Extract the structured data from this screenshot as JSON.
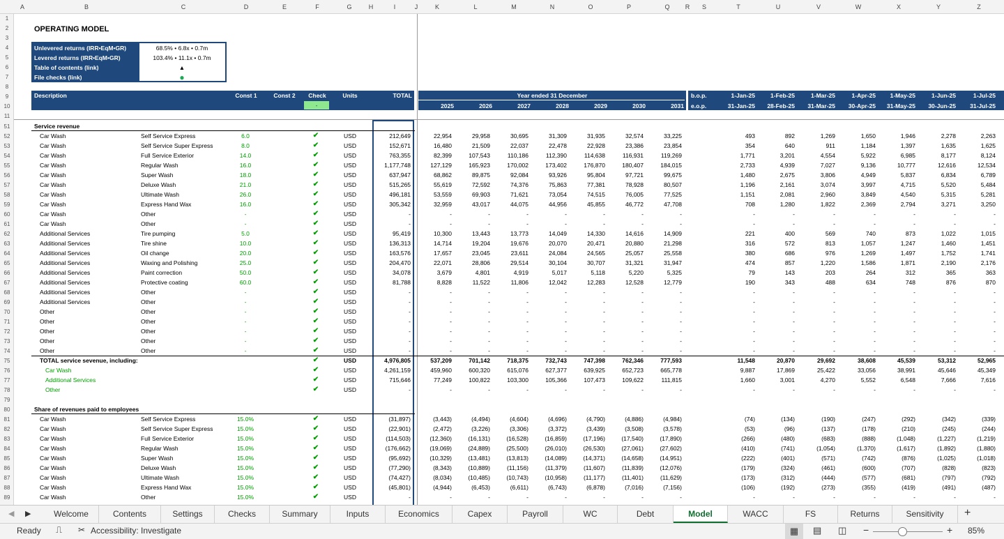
{
  "columns": [
    "A",
    "B",
    "C",
    "D",
    "E",
    "F",
    "G",
    "H",
    "I",
    "J",
    "K",
    "L",
    "M",
    "N",
    "O",
    "P",
    "Q",
    "R",
    "S",
    "T",
    "U",
    "V",
    "W",
    "X",
    "Y",
    "Z"
  ],
  "title": "OPERATING MODEL",
  "summary": [
    {
      "label": "Unlevered returns (IRR•EqM•GR)",
      "value": "68.5% • 6.8x • 0.7m"
    },
    {
      "label": "Levered returns (IRR•EqM•GR)",
      "value": "103.4% • 11.1x • 0.7m"
    },
    {
      "label": "Table of contents (link)",
      "value": "▲"
    },
    {
      "label": "File checks (link)",
      "value": "●"
    }
  ],
  "header": {
    "description": "Description",
    "const1": "Const 1",
    "const2": "Const 2",
    "check": "Check",
    "check_value": "-",
    "units": "Units",
    "total": "TOTAL",
    "year_label": "Year ended 31 December",
    "years": [
      "2025",
      "2026",
      "2027",
      "2028",
      "2029",
      "2030",
      "2031"
    ],
    "bop": "b.o.p.",
    "eop": "e.o.p.",
    "months_start": [
      "1-Jan-25",
      "1-Feb-25",
      "1-Mar-25",
      "1-Apr-25",
      "1-May-25",
      "1-Jun-25",
      "1-Jul-25"
    ],
    "months_end": [
      "31-Jan-25",
      "28-Feb-25",
      "31-Mar-25",
      "30-Apr-25",
      "31-May-25",
      "30-Jun-25",
      "31-Jul-25"
    ]
  },
  "sections": {
    "service_revenue": "Service revenue",
    "share": "Share of revenues paid to employees",
    "total_label": "TOTAL service sevenue, including:"
  },
  "rows": [
    {
      "n": "51",
      "kind": "section",
      "key": "service_revenue"
    },
    {
      "n": "52",
      "a": "Car Wash",
      "b": "Self Service Express",
      "c": "6.0",
      "u": "USD",
      "t": "212,649",
      "y": [
        "22,954",
        "29,958",
        "30,695",
        "31,309",
        "31,935",
        "32,574",
        "33,225"
      ],
      "m": [
        "493",
        "892",
        "1,269",
        "1,650",
        "1,946",
        "2,278",
        "2,263"
      ]
    },
    {
      "n": "53",
      "a": "Car Wash",
      "b": "Self Service Super Express",
      "c": "8.0",
      "u": "USD",
      "t": "152,671",
      "y": [
        "16,480",
        "21,509",
        "22,037",
        "22,478",
        "22,928",
        "23,386",
        "23,854"
      ],
      "m": [
        "354",
        "640",
        "911",
        "1,184",
        "1,397",
        "1,635",
        "1,625"
      ]
    },
    {
      "n": "54",
      "a": "Car Wash",
      "b": "Full Service Exterior",
      "c": "14.0",
      "u": "USD",
      "t": "763,355",
      "y": [
        "82,399",
        "107,543",
        "110,186",
        "112,390",
        "114,638",
        "116,931",
        "119,269"
      ],
      "m": [
        "1,771",
        "3,201",
        "4,554",
        "5,922",
        "6,985",
        "8,177",
        "8,124"
      ]
    },
    {
      "n": "55",
      "a": "Car Wash",
      "b": "Regular Wash",
      "c": "16.0",
      "u": "USD",
      "t": "1,177,748",
      "y": [
        "127,129",
        "165,923",
        "170,002",
        "173,402",
        "176,870",
        "180,407",
        "184,015"
      ],
      "m": [
        "2,733",
        "4,939",
        "7,027",
        "9,136",
        "10,777",
        "12,616",
        "12,534"
      ]
    },
    {
      "n": "56",
      "a": "Car Wash",
      "b": "Super Wash",
      "c": "18.0",
      "u": "USD",
      "t": "637,947",
      "y": [
        "68,862",
        "89,875",
        "92,084",
        "93,926",
        "95,804",
        "97,721",
        "99,675"
      ],
      "m": [
        "1,480",
        "2,675",
        "3,806",
        "4,949",
        "5,837",
        "6,834",
        "6,789"
      ]
    },
    {
      "n": "57",
      "a": "Car Wash",
      "b": "Deluxe Wash",
      "c": "21.0",
      "u": "USD",
      "t": "515,265",
      "y": [
        "55,619",
        "72,592",
        "74,376",
        "75,863",
        "77,381",
        "78,928",
        "80,507"
      ],
      "m": [
        "1,196",
        "2,161",
        "3,074",
        "3,997",
        "4,715",
        "5,520",
        "5,484"
      ]
    },
    {
      "n": "58",
      "a": "Car Wash",
      "b": "Ultimate Wash",
      "c": "26.0",
      "u": "USD",
      "t": "496,181",
      "y": [
        "53,559",
        "69,903",
        "71,621",
        "73,054",
        "74,515",
        "76,005",
        "77,525"
      ],
      "m": [
        "1,151",
        "2,081",
        "2,960",
        "3,849",
        "4,540",
        "5,315",
        "5,281"
      ]
    },
    {
      "n": "59",
      "a": "Car Wash",
      "b": "Express Hand Wax",
      "c": "16.0",
      "u": "USD",
      "t": "305,342",
      "y": [
        "32,959",
        "43,017",
        "44,075",
        "44,956",
        "45,855",
        "46,772",
        "47,708"
      ],
      "m": [
        "708",
        "1,280",
        "1,822",
        "2,369",
        "2,794",
        "3,271",
        "3,250"
      ]
    },
    {
      "n": "60",
      "a": "Car Wash",
      "b": "Other",
      "c": "-",
      "u": "USD",
      "t": "-",
      "y": [
        "-",
        "-",
        "-",
        "-",
        "-",
        "-",
        "-"
      ],
      "m": [
        "-",
        "-",
        "-",
        "-",
        "-",
        "-",
        "-"
      ]
    },
    {
      "n": "61",
      "a": "Car Wash",
      "b": "Other",
      "c": "-",
      "u": "USD",
      "t": "-",
      "y": [
        "-",
        "-",
        "-",
        "-",
        "-",
        "-",
        "-"
      ],
      "m": [
        "-",
        "-",
        "-",
        "-",
        "-",
        "-",
        "-"
      ]
    },
    {
      "n": "62",
      "a": "Additional Services",
      "b": "Tire pumping",
      "c": "5.0",
      "u": "USD",
      "t": "95,419",
      "y": [
        "10,300",
        "13,443",
        "13,773",
        "14,049",
        "14,330",
        "14,616",
        "14,909"
      ],
      "m": [
        "221",
        "400",
        "569",
        "740",
        "873",
        "1,022",
        "1,015"
      ]
    },
    {
      "n": "63",
      "a": "Additional Services",
      "b": "Tire shine",
      "c": "10.0",
      "u": "USD",
      "t": "136,313",
      "y": [
        "14,714",
        "19,204",
        "19,676",
        "20,070",
        "20,471",
        "20,880",
        "21,298"
      ],
      "m": [
        "316",
        "572",
        "813",
        "1,057",
        "1,247",
        "1,460",
        "1,451"
      ]
    },
    {
      "n": "64",
      "a": "Additional Services",
      "b": "Oil change",
      "c": "20.0",
      "u": "USD",
      "t": "163,576",
      "y": [
        "17,657",
        "23,045",
        "23,611",
        "24,084",
        "24,565",
        "25,057",
        "25,558"
      ],
      "m": [
        "380",
        "686",
        "976",
        "1,269",
        "1,497",
        "1,752",
        "1,741"
      ]
    },
    {
      "n": "65",
      "a": "Additional Services",
      "b": "Waxing and Polishing",
      "c": "25.0",
      "u": "USD",
      "t": "204,470",
      "y": [
        "22,071",
        "28,806",
        "29,514",
        "30,104",
        "30,707",
        "31,321",
        "31,947"
      ],
      "m": [
        "474",
        "857",
        "1,220",
        "1,586",
        "1,871",
        "2,190",
        "2,176"
      ]
    },
    {
      "n": "66",
      "a": "Additional Services",
      "b": "Paint correction",
      "c": "50.0",
      "u": "USD",
      "t": "34,078",
      "y": [
        "3,679",
        "4,801",
        "4,919",
        "5,017",
        "5,118",
        "5,220",
        "5,325"
      ],
      "m": [
        "79",
        "143",
        "203",
        "264",
        "312",
        "365",
        "363"
      ]
    },
    {
      "n": "67",
      "a": "Additional Services",
      "b": "Protective coating",
      "c": "60.0",
      "u": "USD",
      "t": "81,788",
      "y": [
        "8,828",
        "11,522",
        "11,806",
        "12,042",
        "12,283",
        "12,528",
        "12,779"
      ],
      "m": [
        "190",
        "343",
        "488",
        "634",
        "748",
        "876",
        "870"
      ]
    },
    {
      "n": "68",
      "a": "Additional Services",
      "b": "Other",
      "c": "-",
      "u": "USD",
      "t": "-",
      "y": [
        "-",
        "-",
        "-",
        "-",
        "-",
        "-",
        "-"
      ],
      "m": [
        "-",
        "-",
        "-",
        "-",
        "-",
        "-",
        "-"
      ]
    },
    {
      "n": "69",
      "a": "Additional Services",
      "b": "Other",
      "c": "-",
      "u": "USD",
      "t": "-",
      "y": [
        "-",
        "-",
        "-",
        "-",
        "-",
        "-",
        "-"
      ],
      "m": [
        "-",
        "-",
        "-",
        "-",
        "-",
        "-",
        "-"
      ]
    },
    {
      "n": "70",
      "a": "Other",
      "b": "Other",
      "c": "-",
      "u": "USD",
      "t": "-",
      "y": [
        "-",
        "-",
        "-",
        "-",
        "-",
        "-",
        "-"
      ],
      "m": [
        "-",
        "-",
        "-",
        "-",
        "-",
        "-",
        "-"
      ]
    },
    {
      "n": "71",
      "a": "Other",
      "b": "Other",
      "c": "-",
      "u": "USD",
      "t": "-",
      "y": [
        "-",
        "-",
        "-",
        "-",
        "-",
        "-",
        "-"
      ],
      "m": [
        "-",
        "-",
        "-",
        "-",
        "-",
        "-",
        "-"
      ]
    },
    {
      "n": "72",
      "a": "Other",
      "b": "Other",
      "c": "-",
      "u": "USD",
      "t": "-",
      "y": [
        "-",
        "-",
        "-",
        "-",
        "-",
        "-",
        "-"
      ],
      "m": [
        "-",
        "-",
        "-",
        "-",
        "-",
        "-",
        "-"
      ]
    },
    {
      "n": "73",
      "a": "Other",
      "b": "Other",
      "c": "-",
      "u": "USD",
      "t": "-",
      "y": [
        "-",
        "-",
        "-",
        "-",
        "-",
        "-",
        "-"
      ],
      "m": [
        "-",
        "-",
        "-",
        "-",
        "-",
        "-",
        "-"
      ]
    },
    {
      "n": "74",
      "a": "Other",
      "b": "Other",
      "c": "-",
      "u": "USD",
      "t": "-",
      "y": [
        "-",
        "-",
        "-",
        "-",
        "-",
        "-",
        "-"
      ],
      "m": [
        "-",
        "-",
        "-",
        "-",
        "-",
        "-",
        "-"
      ]
    },
    {
      "n": "75",
      "kind": "total",
      "u": "USD",
      "t": "4,976,805",
      "y": [
        "537,209",
        "701,142",
        "718,375",
        "732,743",
        "747,398",
        "762,346",
        "777,593"
      ],
      "m": [
        "11,548",
        "20,870",
        "29,692",
        "38,608",
        "45,539",
        "53,312",
        "52,965"
      ]
    },
    {
      "n": "76",
      "kind": "sub",
      "a": "Car Wash",
      "u": "USD",
      "t": "4,261,159",
      "y": [
        "459,960",
        "600,320",
        "615,076",
        "627,377",
        "639,925",
        "652,723",
        "665,778"
      ],
      "m": [
        "9,887",
        "17,869",
        "25,422",
        "33,056",
        "38,991",
        "45,646",
        "45,349"
      ]
    },
    {
      "n": "77",
      "kind": "sub",
      "a": "Additional Services",
      "u": "USD",
      "t": "715,646",
      "y": [
        "77,249",
        "100,822",
        "103,300",
        "105,366",
        "107,473",
        "109,622",
        "111,815"
      ],
      "m": [
        "1,660",
        "3,001",
        "4,270",
        "5,552",
        "6,548",
        "7,666",
        "7,616"
      ]
    },
    {
      "n": "78",
      "kind": "sub",
      "a": "Other",
      "u": "USD",
      "t": "-",
      "y": [
        "-",
        "-",
        "-",
        "-",
        "-",
        "-",
        "-"
      ],
      "m": [
        "-",
        "-",
        "-",
        "-",
        "-",
        "-",
        "-"
      ]
    },
    {
      "n": "79",
      "kind": "blank"
    },
    {
      "n": "80",
      "kind": "section",
      "key": "share"
    },
    {
      "n": "81",
      "a": "Car Wash",
      "b": "Self Service Express",
      "c": "15.0%",
      "u": "USD",
      "t": "(31,897)",
      "y": [
        "(3,443)",
        "(4,494)",
        "(4,604)",
        "(4,696)",
        "(4,790)",
        "(4,886)",
        "(4,984)"
      ],
      "m": [
        "(74)",
        "(134)",
        "(190)",
        "(247)",
        "(292)",
        "(342)",
        "(339)"
      ]
    },
    {
      "n": "82",
      "a": "Car Wash",
      "b": "Self Service Super Express",
      "c": "15.0%",
      "u": "USD",
      "t": "(22,901)",
      "y": [
        "(2,472)",
        "(3,226)",
        "(3,306)",
        "(3,372)",
        "(3,439)",
        "(3,508)",
        "(3,578)"
      ],
      "m": [
        "(53)",
        "(96)",
        "(137)",
        "(178)",
        "(210)",
        "(245)",
        "(244)"
      ]
    },
    {
      "n": "83",
      "a": "Car Wash",
      "b": "Full Service Exterior",
      "c": "15.0%",
      "u": "USD",
      "t": "(114,503)",
      "y": [
        "(12,360)",
        "(16,131)",
        "(16,528)",
        "(16,859)",
        "(17,196)",
        "(17,540)",
        "(17,890)"
      ],
      "m": [
        "(266)",
        "(480)",
        "(683)",
        "(888)",
        "(1,048)",
        "(1,227)",
        "(1,219)"
      ]
    },
    {
      "n": "84",
      "a": "Car Wash",
      "b": "Regular Wash",
      "c": "15.0%",
      "u": "USD",
      "t": "(176,662)",
      "y": [
        "(19,069)",
        "(24,889)",
        "(25,500)",
        "(26,010)",
        "(26,530)",
        "(27,061)",
        "(27,602)"
      ],
      "m": [
        "(410)",
        "(741)",
        "(1,054)",
        "(1,370)",
        "(1,617)",
        "(1,892)",
        "(1,880)"
      ]
    },
    {
      "n": "85",
      "a": "Car Wash",
      "b": "Super Wash",
      "c": "15.0%",
      "u": "USD",
      "t": "(95,692)",
      "y": [
        "(10,329)",
        "(13,481)",
        "(13,813)",
        "(14,089)",
        "(14,371)",
        "(14,658)",
        "(14,951)"
      ],
      "m": [
        "(222)",
        "(401)",
        "(571)",
        "(742)",
        "(876)",
        "(1,025)",
        "(1,018)"
      ]
    },
    {
      "n": "86",
      "a": "Car Wash",
      "b": "Deluxe Wash",
      "c": "15.0%",
      "u": "USD",
      "t": "(77,290)",
      "y": [
        "(8,343)",
        "(10,889)",
        "(11,156)",
        "(11,379)",
        "(11,607)",
        "(11,839)",
        "(12,076)"
      ],
      "m": [
        "(179)",
        "(324)",
        "(461)",
        "(600)",
        "(707)",
        "(828)",
        "(823)"
      ]
    },
    {
      "n": "87",
      "a": "Car Wash",
      "b": "Ultimate Wash",
      "c": "15.0%",
      "u": "USD",
      "t": "(74,427)",
      "y": [
        "(8,034)",
        "(10,485)",
        "(10,743)",
        "(10,958)",
        "(11,177)",
        "(11,401)",
        "(11,629)"
      ],
      "m": [
        "(173)",
        "(312)",
        "(444)",
        "(577)",
        "(681)",
        "(797)",
        "(792)"
      ]
    },
    {
      "n": "88",
      "a": "Car Wash",
      "b": "Express Hand Wax",
      "c": "15.0%",
      "u": "USD",
      "t": "(45,801)",
      "y": [
        "(4,944)",
        "(6,453)",
        "(6,611)",
        "(6,743)",
        "(6,878)",
        "(7,016)",
        "(7,156)"
      ],
      "m": [
        "(106)",
        "(192)",
        "(273)",
        "(355)",
        "(419)",
        "(491)",
        "(487)"
      ]
    },
    {
      "n": "89",
      "a": "Car Wash",
      "b": "Other",
      "c": "15.0%",
      "u": "USD",
      "t": "-",
      "y": [
        "-",
        "-",
        "-",
        "-",
        "-",
        "-",
        "-"
      ],
      "m": [
        "-",
        "-",
        "-",
        "-",
        "-",
        "-",
        "-"
      ]
    }
  ],
  "top_rows": [
    "1",
    "2",
    "3",
    "4",
    "5",
    "6",
    "7",
    "8",
    "9",
    "10",
    "11"
  ],
  "tabs": [
    "Welcome",
    "Contents",
    "Settings",
    "Checks",
    "Summary",
    "Inputs",
    "Economics",
    "Capex",
    "Payroll",
    "WC",
    "Debt",
    "Model",
    "WACC",
    "FS",
    "Returns",
    "Sensitivity"
  ],
  "active_tab": "Model",
  "status": {
    "ready": "Ready",
    "accessibility": "Accessibility: Investigate",
    "zoom": "85%"
  },
  "colors": {
    "header_bg": "#1f497d",
    "green": "#00a000",
    "active_tab": "#0f6f2f"
  }
}
